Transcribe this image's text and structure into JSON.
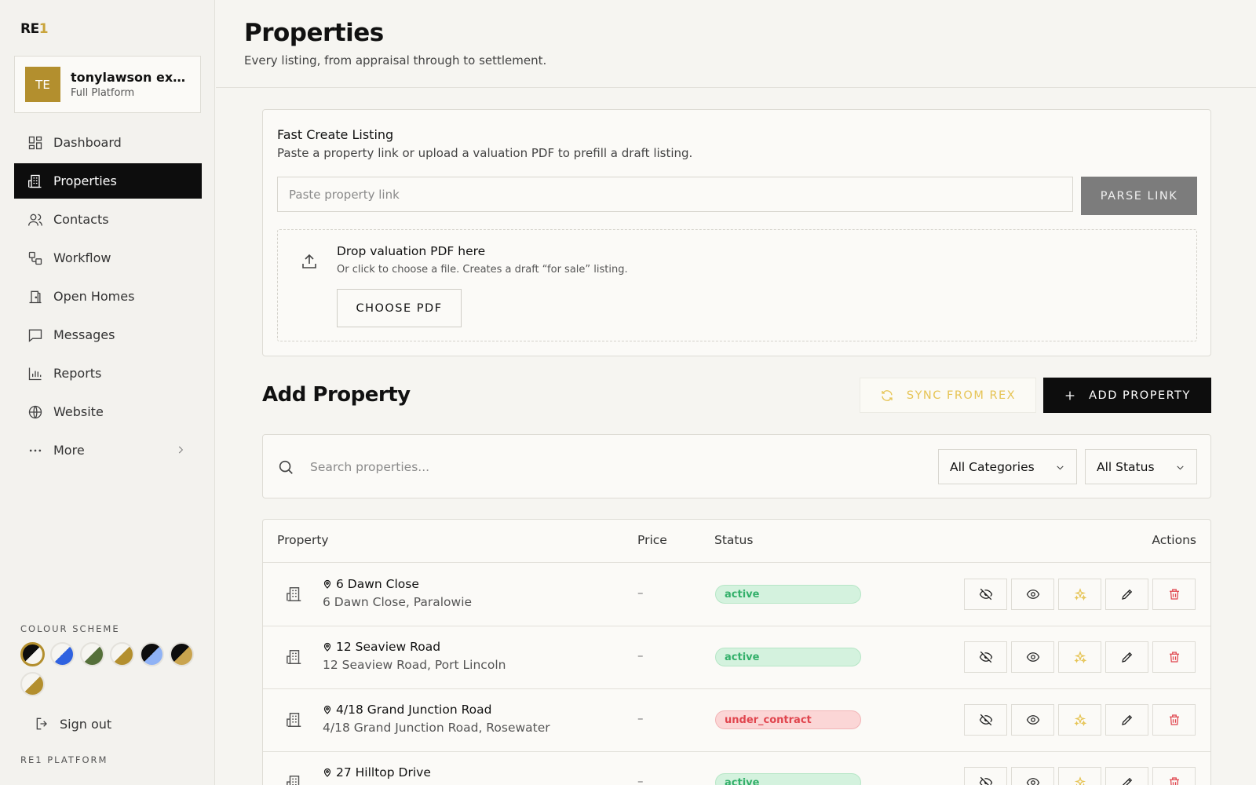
{
  "sidebar": {
    "logo_text": "RE",
    "logo_accent": "1",
    "account": {
      "initials": "TE",
      "name": "tonylawson exp &...",
      "plan": "Full Platform"
    },
    "nav": [
      {
        "label": "Dashboard",
        "icon": "dashboard-icon",
        "active": false
      },
      {
        "label": "Properties",
        "icon": "building-icon",
        "active": true
      },
      {
        "label": "Contacts",
        "icon": "users-icon",
        "active": false
      },
      {
        "label": "Workflow",
        "icon": "workflow-icon",
        "active": false
      },
      {
        "label": "Open Homes",
        "icon": "open-home-icon",
        "active": false
      },
      {
        "label": "Messages",
        "icon": "message-icon",
        "active": false
      },
      {
        "label": "Reports",
        "icon": "chart-icon",
        "active": false
      },
      {
        "label": "Website",
        "icon": "globe-icon",
        "active": false
      },
      {
        "label": "More",
        "icon": "more-icon",
        "active": false
      }
    ],
    "colour_scheme_label": "COLOUR SCHEME",
    "swatches": [
      {
        "a": "#0d0d0d",
        "b": "#f6f5f1",
        "selected": true
      },
      {
        "a": "#f6f5f1",
        "b": "#2f62e0",
        "selected": false
      },
      {
        "a": "#f6f5f1",
        "b": "#55703a",
        "selected": false
      },
      {
        "a": "#f6f5f1",
        "b": "#b38f2e",
        "selected": false
      },
      {
        "a": "#0d0d0d",
        "b": "#8fb2f5",
        "selected": false
      },
      {
        "a": "#0d0d0d",
        "b": "#c9a44e",
        "selected": false
      },
      {
        "a": "#f6f5f1",
        "b": "#b38f2e",
        "selected": false
      }
    ],
    "sign_out": "Sign out",
    "platform_label": "RE1 PLATFORM"
  },
  "header": {
    "title": "Properties",
    "subtitle": "Every listing, from appraisal through to settlement."
  },
  "fast_create": {
    "title": "Fast Create Listing",
    "subtitle": "Paste a property link or upload a valuation PDF to prefill a draft listing.",
    "link_placeholder": "Paste property link",
    "parse_button": "PARSE LINK",
    "drop_title": "Drop valuation PDF here",
    "drop_subtitle": "Or click to choose a file. Creates a draft “for sale” listing.",
    "choose_button": "CHOOSE PDF"
  },
  "add_property": {
    "title": "Add Property",
    "sync_button": "SYNC FROM REX",
    "add_button": "ADD PROPERTY"
  },
  "filters": {
    "search_placeholder": "Search properties...",
    "category": "All Categories",
    "status": "All Status"
  },
  "table": {
    "columns": {
      "property": "Property",
      "price": "Price",
      "status": "Status",
      "actions": "Actions"
    },
    "rows": [
      {
        "title": "6 Dawn Close",
        "address": "6 Dawn Close, Paralowie",
        "price": "–",
        "status": "active"
      },
      {
        "title": "12 Seaview Road",
        "address": "12 Seaview Road, Port Lincoln",
        "price": "–",
        "status": "active"
      },
      {
        "title": "4/18 Grand Junction Road",
        "address": "4/18 Grand Junction Road, Rosewater",
        "price": "–",
        "status": "under_contract"
      },
      {
        "title": "27 Hilltop Drive",
        "address": "",
        "price": "–",
        "status": "active"
      }
    ],
    "action_icons": [
      "hide-icon",
      "view-icon",
      "sparkle-icon",
      "edit-icon",
      "delete-icon"
    ]
  },
  "colors": {
    "accent_gold": "#b38f2e",
    "active_nav_bg": "#0d0d0d",
    "status_active_bg": "#d4f2de",
    "status_active_text": "#33b06a",
    "status_contract_bg": "#fbd6d6",
    "status_contract_text": "#e0454e",
    "sync_text": "#e6c455",
    "delete_red": "#e0454e"
  }
}
